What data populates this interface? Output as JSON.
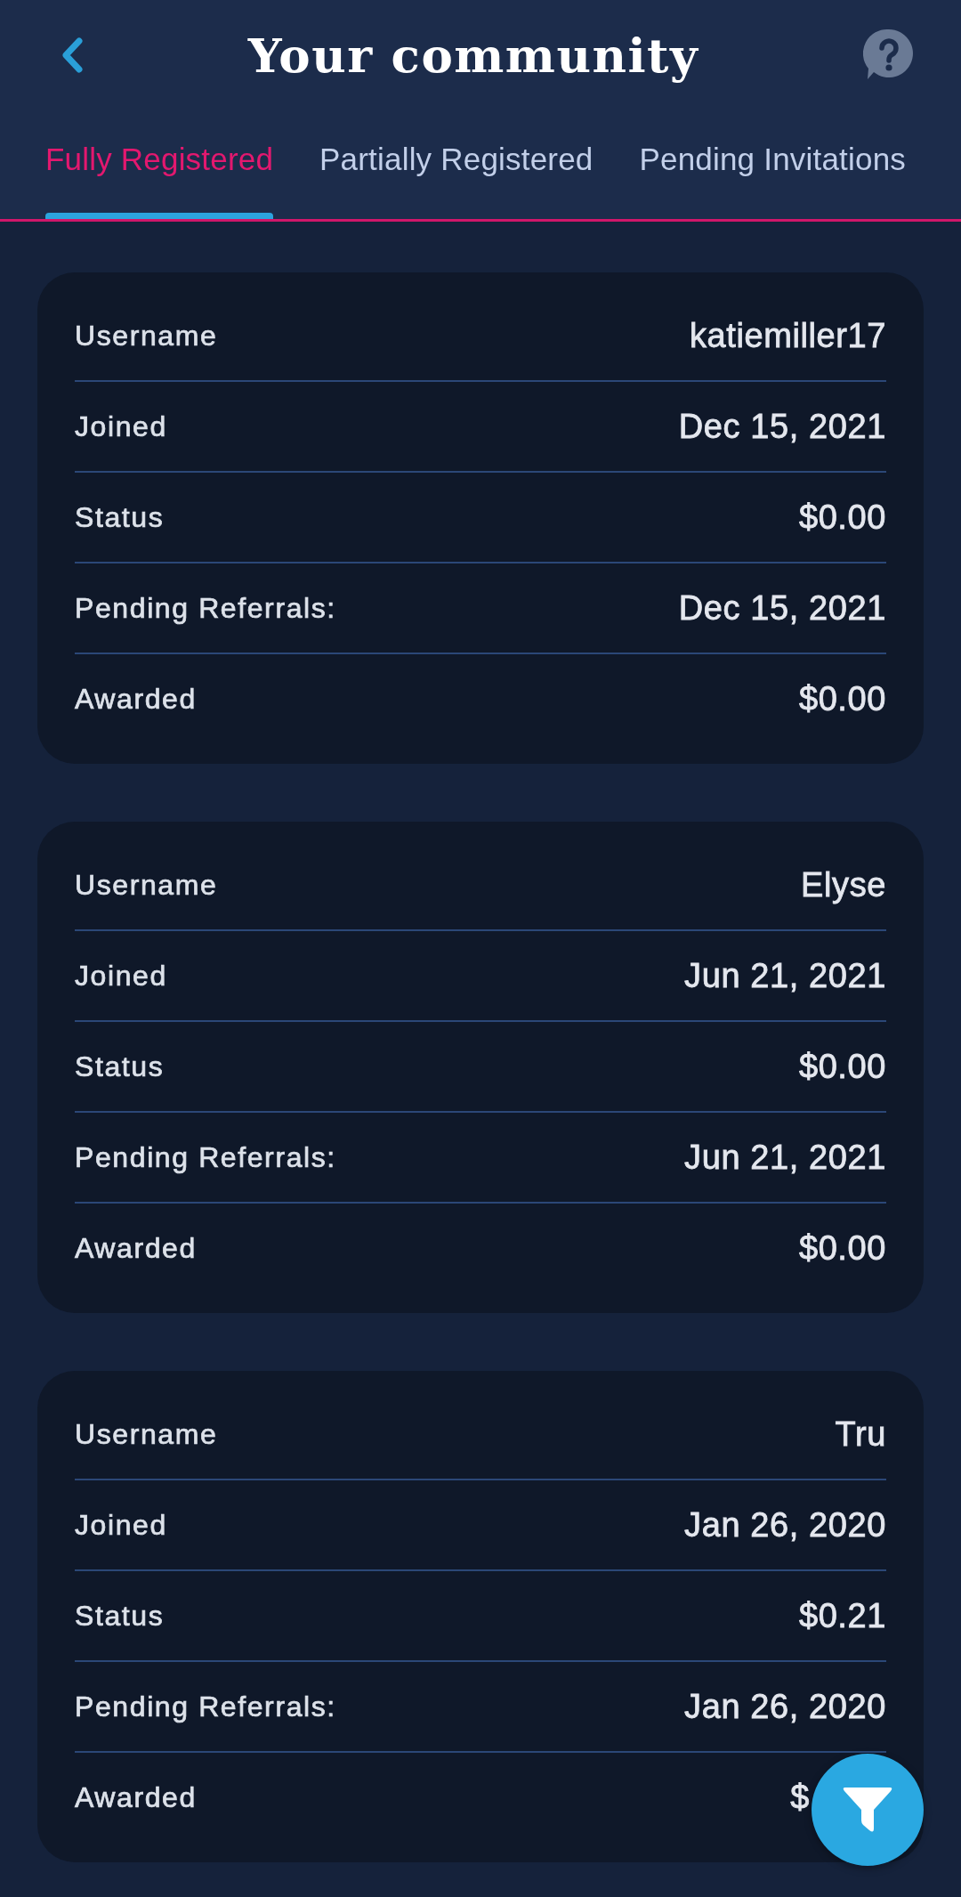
{
  "header": {
    "title": "Your community"
  },
  "tabs": [
    {
      "label": "Fully Registered",
      "selected": true
    },
    {
      "label": "Partially Registered",
      "selected": false
    },
    {
      "label": "Pending Invitations",
      "selected": false
    }
  ],
  "members": [
    {
      "rows": [
        {
          "label": "Username",
          "value": "katiemiller17"
        },
        {
          "label": "Joined",
          "value": "Dec 15, 2021"
        },
        {
          "label": "Status",
          "value": "$0.00"
        },
        {
          "label": "Pending Referrals:",
          "value": "Dec 15, 2021"
        },
        {
          "label": "Awarded",
          "value": "$0.00"
        }
      ]
    },
    {
      "rows": [
        {
          "label": "Username",
          "value": "Elyse"
        },
        {
          "label": "Joined",
          "value": "Jun 21, 2021"
        },
        {
          "label": "Status",
          "value": "$0.00"
        },
        {
          "label": "Pending Referrals:",
          "value": "Jun 21, 2021"
        },
        {
          "label": "Awarded",
          "value": "$0.00"
        }
      ]
    },
    {
      "rows": [
        {
          "label": "Username",
          "value": "Tru"
        },
        {
          "label": "Joined",
          "value": "Jan 26, 2020"
        },
        {
          "label": "Status",
          "value": "$0.21"
        },
        {
          "label": "Pending Referrals:",
          "value": "Jan 26, 2020"
        },
        {
          "label": "Awarded",
          "value": "$"
        }
      ]
    }
  ]
}
